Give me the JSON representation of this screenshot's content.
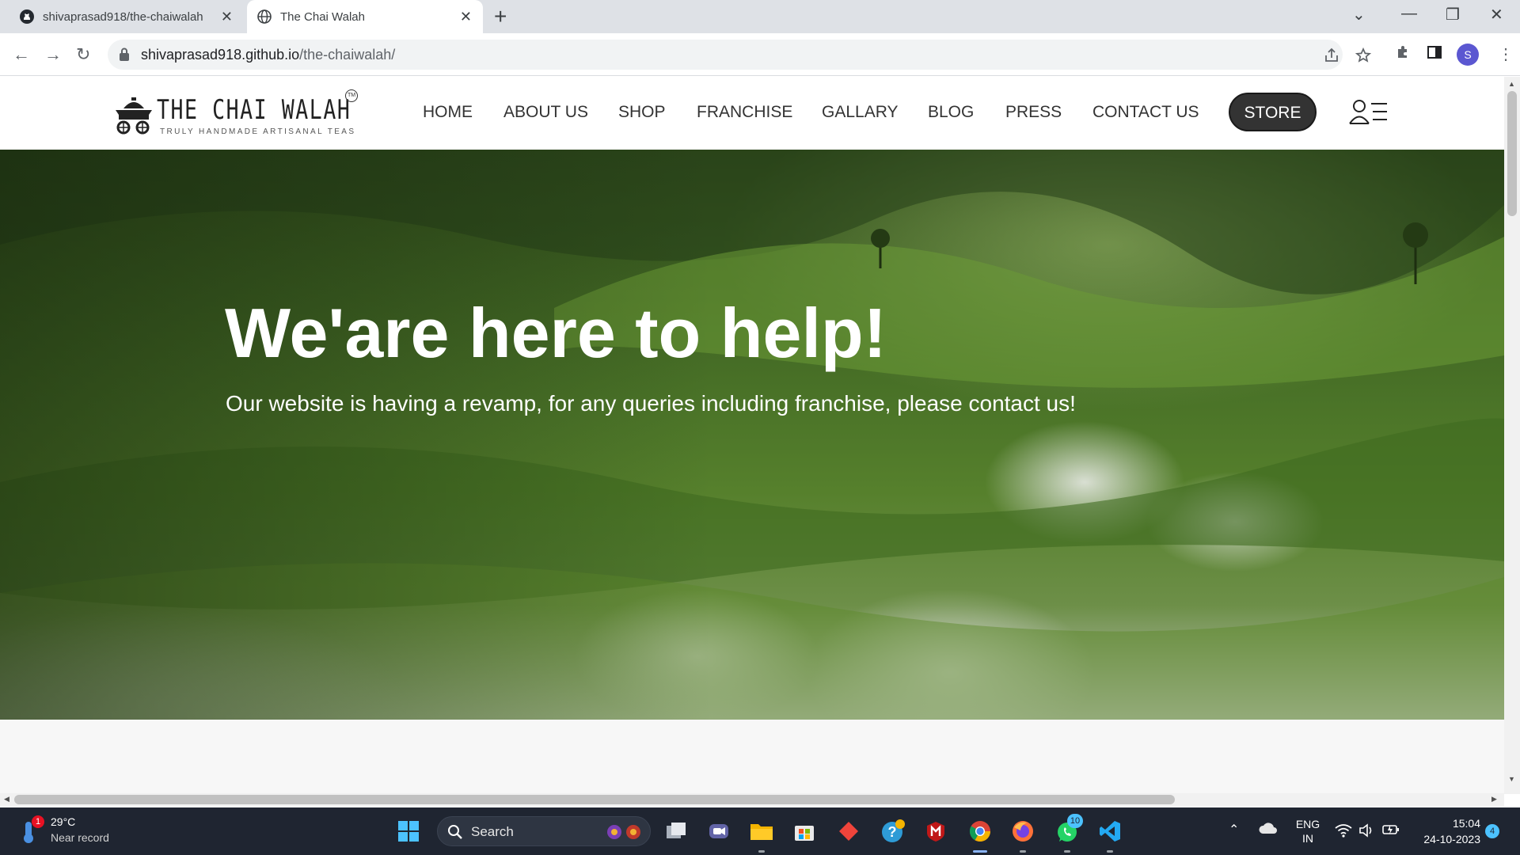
{
  "browser": {
    "tabs": [
      {
        "title": "shivaprasad918/the-chaiwalah",
        "active": false,
        "icon": "github-icon"
      },
      {
        "title": "The Chai Walah",
        "active": true,
        "icon": "globe-icon"
      }
    ],
    "url_host": "shivaprasad918.github.io",
    "url_path": "/the-chaiwalah/",
    "profile_initial": "S"
  },
  "site": {
    "logo_text": "THE CHAI WALAH",
    "logo_tagline": "TRULY HANDMADE ARTISANAL TEAS",
    "logo_tm": "TM",
    "nav": [
      "HOME",
      "ABOUT US",
      "SHOP",
      "FRANCHISE",
      "GALLARY",
      "BLOG",
      "PRESS",
      "CONTACT US"
    ],
    "store_label": "STORE"
  },
  "hero": {
    "title": "We'are here to help!",
    "subtitle": "Our website is having a revamp, for any queries including franchise, please contact us!"
  },
  "taskbar": {
    "weather_temp": "29°C",
    "weather_desc": "Near record",
    "weather_badge": "1",
    "search_label": "Search",
    "whatsapp_badge": "10",
    "lang_line1": "ENG",
    "lang_line2": "IN",
    "time": "15:04",
    "date": "24-10-2023",
    "notifications": "4"
  },
  "colors": {
    "store_bg": "#333333",
    "taskbar_bg": "#1f2531",
    "profile_bg": "#5b57d1"
  }
}
